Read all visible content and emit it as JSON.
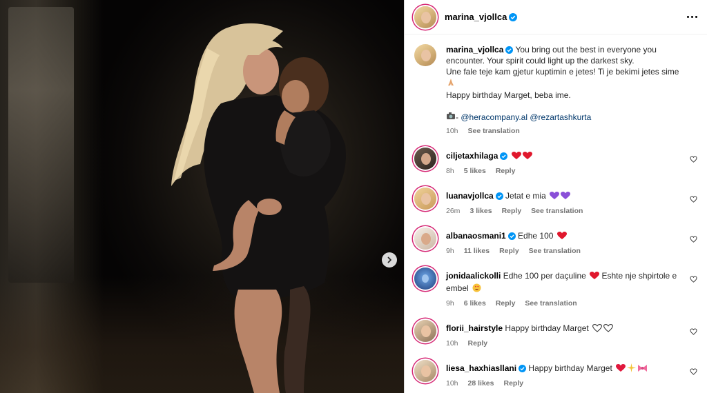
{
  "post": {
    "username": "marina_vjollca",
    "caption_lines": [
      "You bring out the best in everyone you encounter. Your spirit could light up the darkest sky.",
      "Une fale teje kam gjetur kuptimin e jetes! Ti je bekimi jetes sime",
      "Happy birthday Marget, beba ime."
    ],
    "credit_prefix": "- ",
    "credit_handle_1": "@heracompany.al",
    "credit_handle_2": "@rezartashkurta",
    "time": "10h",
    "see_translation": "See translation"
  },
  "labels": {
    "reply": "Reply",
    "see_translation": "See translation"
  },
  "comments": [
    {
      "username": "ciljetaxhilaga",
      "verified": true,
      "text": "",
      "time": "8h",
      "likes": "5 likes",
      "translation": false
    },
    {
      "username": "luanavjollca",
      "verified": true,
      "text": "Jetat e mia",
      "time": "26m",
      "likes": "3 likes",
      "translation": true
    },
    {
      "username": "albanaosmani1",
      "verified": true,
      "text": "Edhe 100",
      "time": "9h",
      "likes": "11 likes",
      "translation": true
    },
    {
      "username": "jonidaalickolli",
      "verified": false,
      "text": "Edhe 100 per daçuline",
      "text2": "Eshte nje shpirtole e embel",
      "time": "9h",
      "likes": "6 likes",
      "translation": true
    },
    {
      "username": "florii_hairstyle",
      "verified": false,
      "text": "Happy birthday Marget",
      "time": "10h",
      "likes": "",
      "translation": false
    },
    {
      "username": "liesa_haxhiasllani",
      "verified": true,
      "text": "Happy birthday Marget",
      "time": "10h",
      "likes": "28 likes",
      "translation": false
    }
  ],
  "colors": {
    "verified": "#0095f6",
    "link": "#00376b",
    "secondary": "#737373",
    "heart": "#ed4956"
  },
  "icons": [
    "verified-badge-icon",
    "more-options-icon",
    "heart-outline-icon",
    "chevron-right-icon",
    "camera-emoji-icon",
    "pray-emoji-icon",
    "red-heart-emoji-icon",
    "purple-heart-emoji-icon"
  ]
}
